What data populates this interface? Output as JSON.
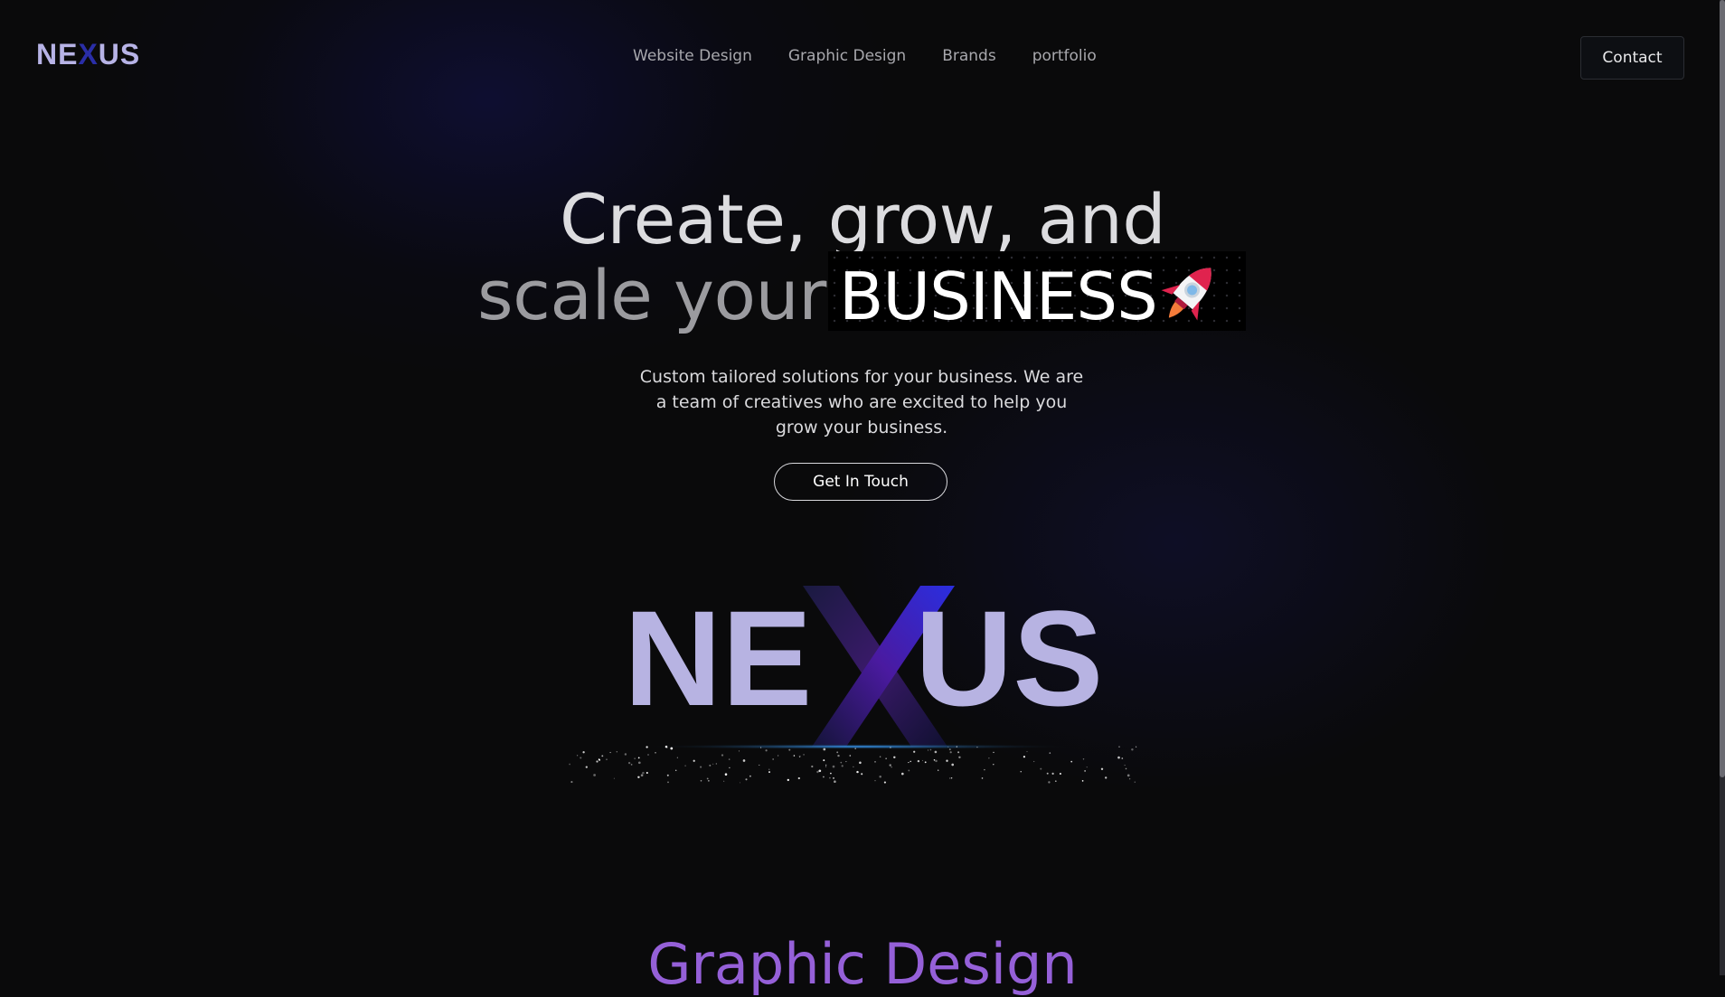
{
  "brand": {
    "logo_text": "NEXUS",
    "logo_left": "NE",
    "logo_x": "X",
    "logo_right": "US"
  },
  "nav": {
    "items": [
      "Website Design",
      "Graphic Design",
      "Brands",
      "portfolio"
    ]
  },
  "header": {
    "contact_label": "Contact"
  },
  "hero": {
    "line1": "Create, grow, and",
    "line2": "scale your",
    "highlight": "BUSINESS",
    "subtitle": "Custom tailored solutions for your business. We are a team of creatives who are excited to help you grow your business.",
    "cta_label": "Get In Touch"
  },
  "big_logo": {
    "left": "NE",
    "x": "X",
    "right": "US"
  },
  "section": {
    "title": "Graphic Design"
  },
  "colors": {
    "accent_purple": "#9560d8",
    "logo_lavender": "#b7b3e6",
    "logo_blue": "#2a2ea8",
    "background": "#0a0a0b"
  },
  "icons": [
    "rocket-icon"
  ]
}
